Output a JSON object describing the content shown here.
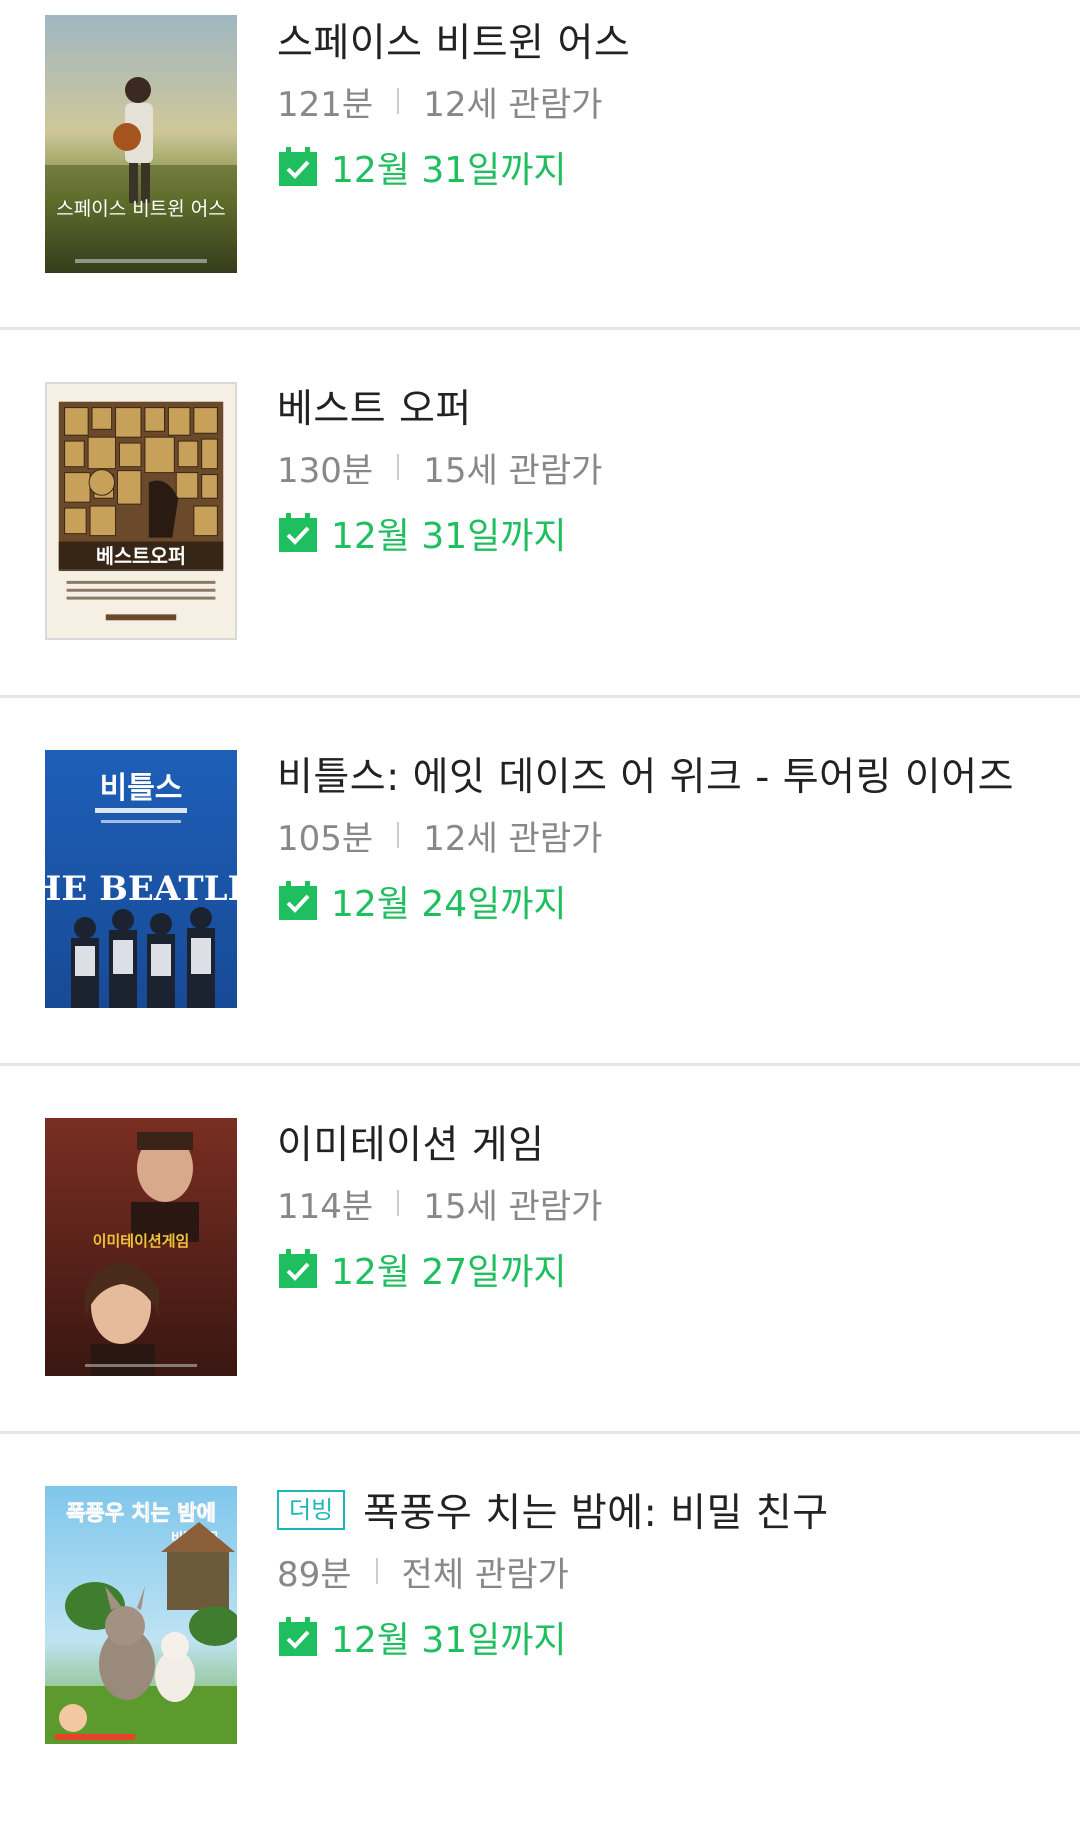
{
  "movies": [
    {
      "title": "스페이스 비트윈 어스",
      "runtime": "121분",
      "rating": "12세 관람가",
      "until": "12월 31일까지",
      "poster_text": "스페이스 비트윈 어스",
      "poster_icon": "movie-poster-space-between-us"
    },
    {
      "title": "베스트 오퍼",
      "runtime": "130분",
      "rating": "15세 관람가",
      "until": "12월 31일까지",
      "poster_text": "베스트오퍼",
      "poster_icon": "movie-poster-best-offer"
    },
    {
      "title": "비틀스: 에잇 데이즈 어 위크 - 투어링 이어즈",
      "runtime": "105분",
      "rating": "12세 관람가",
      "until": "12월 24일까지",
      "poster_text": "비틀스",
      "poster_text2": "THE BEATLES",
      "poster_icon": "movie-poster-beatles"
    },
    {
      "title": "이미테이션 게임",
      "runtime": "114분",
      "rating": "15세 관람가",
      "until": "12월 27일까지",
      "poster_text": "이미테이션게임",
      "poster_icon": "movie-poster-imitation-game"
    },
    {
      "badge": "더빙",
      "title": "폭풍우 치는 밤에: 비밀 친구",
      "runtime": "89분",
      "rating": "전체 관람가",
      "until": "12월 31일까지",
      "poster_text": "폭풍우 치는 밤에",
      "poster_text2": "비밀친구",
      "poster_icon": "movie-poster-stormy-night"
    }
  ],
  "colors": {
    "accent_green": "#1fbf5f",
    "badge_teal": "#1db6b9",
    "title_text": "#222222",
    "meta_text": "#888888",
    "divider": "#e4e4e4"
  },
  "icons": {
    "until": "calendar-check-icon"
  }
}
